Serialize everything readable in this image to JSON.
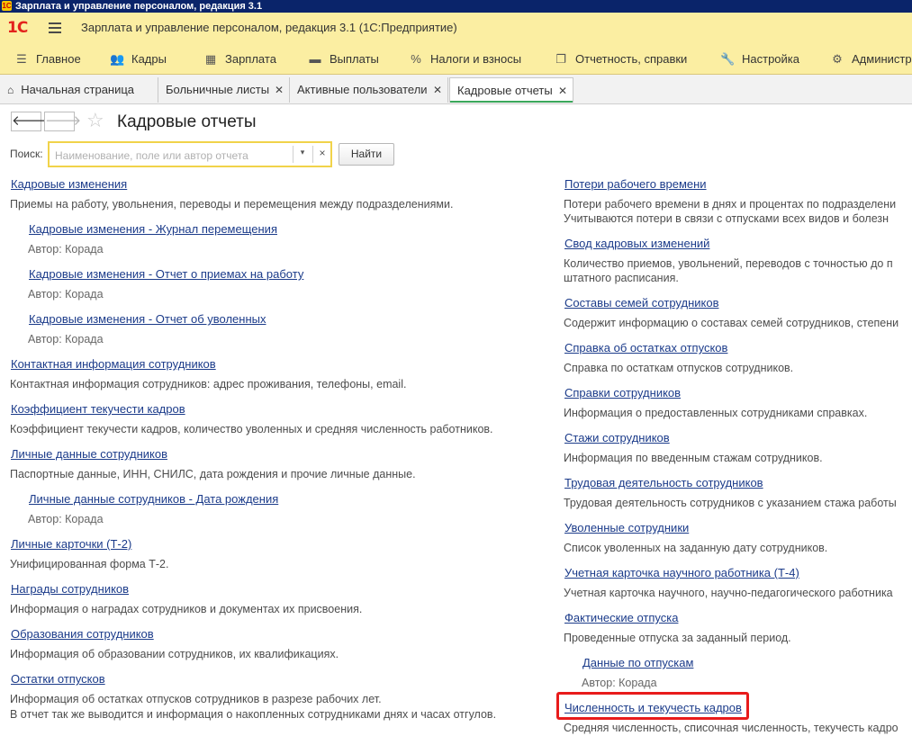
{
  "window": {
    "title": "Зарплата и управление персоналом, редакция 3.1"
  },
  "app": {
    "logo": "1С",
    "title": "Зарплата и управление персоналом, редакция 3.1  (1С:Предприятие)"
  },
  "sections": [
    {
      "label": "Главное",
      "icon": "hamburger-icon"
    },
    {
      "label": "Кадры",
      "icon": "people-icon"
    },
    {
      "label": "Зарплата",
      "icon": "calculator-icon"
    },
    {
      "label": "Выплаты",
      "icon": "wallet-icon"
    },
    {
      "label": "Налоги и взносы",
      "icon": "percent-icon"
    },
    {
      "label": "Отчетность, справки",
      "icon": "documents-icon"
    },
    {
      "label": "Настройка",
      "icon": "wrench-icon"
    },
    {
      "label": "Администрирование",
      "icon": "gear-icon"
    }
  ],
  "tabs": [
    {
      "label": "Начальная страница"
    },
    {
      "label": "Больничные листы"
    },
    {
      "label": "Активные пользователи"
    },
    {
      "label": "Кадровые отчеты"
    }
  ],
  "form": {
    "title": "Кадровые отчеты",
    "search_label": "Поиск:",
    "search_placeholder": "Наименование, поле или автор отчета",
    "search_value": "",
    "find_button": "Найти"
  },
  "left_reports": [
    {
      "name": "Кадровые изменения",
      "desc": "Приемы на работу, увольнения, переводы и перемещения между подразделениями."
    },
    {
      "name": "Кадровые изменения - Журнал перемещения",
      "author": "Автор: Корада"
    },
    {
      "name": "Кадровые изменения - Отчет о приемах на работу",
      "author": "Автор: Корада"
    },
    {
      "name": "Кадровые изменения - Отчет об уволенных",
      "author": "Автор: Корада"
    },
    {
      "name": "Контактная информация сотрудников",
      "desc": "Контактная информация сотрудников: адрес проживания, телефоны, email."
    },
    {
      "name": "Коэффициент текучести кадров",
      "desc": "Коэффициент текучести кадров, количество уволенных и средняя численность работников."
    },
    {
      "name": "Личные данные сотрудников",
      "desc": "Паспортные данные, ИНН, СНИЛС, дата рождения и прочие личные данные."
    },
    {
      "name": "Личные данные сотрудников - Дата рождения",
      "author": "Автор: Корада"
    },
    {
      "name": "Личные карточки (Т-2)",
      "desc": "Унифицированная форма Т-2."
    },
    {
      "name": "Награды сотрудников",
      "desc": "Информация о наградах сотрудников и документах их присвоения."
    },
    {
      "name": "Образования сотрудников",
      "desc": "Информация об образовании сотрудников, их квалификациях."
    },
    {
      "name": "Остатки отпусков",
      "desc": "Информация об остатках отпусков сотрудников в разрезе рабочих лет.",
      "desc2": "В отчет так же выводится и информация о накопленных сотрудниками днях и часах отгулов."
    }
  ],
  "right_reports": [
    {
      "name": "Потери рабочего времени",
      "desc": "Потери рабочего времени в днях и процентах по подразделени",
      "desc2": "Учитываются потери в связи с отпусками всех видов и болезн"
    },
    {
      "name": "Свод кадровых изменений",
      "desc": "Количество приемов, увольнений, переводов с точностью до п",
      "desc2": "штатного расписания."
    },
    {
      "name": "Составы семей сотрудников",
      "desc": "Содержит информацию о составах семей сотрудников, степени"
    },
    {
      "name": "Справка об остатках отпусков",
      "desc": "Справка по остаткам отпусков сотрудников."
    },
    {
      "name": "Справки сотрудников",
      "desc": "Информация о предоставленных сотрудниками справках."
    },
    {
      "name": "Стажи сотрудников",
      "desc": "Информация по введенным стажам сотрудников."
    },
    {
      "name": "Трудовая деятельность сотрудников",
      "desc": "Трудовая деятельность сотрудников с указанием стажа работы"
    },
    {
      "name": "Уволенные сотрудники",
      "desc": "Список уволенных на заданную дату сотрудников."
    },
    {
      "name": "Учетная карточка научного работника (Т-4)",
      "desc": "Учетная карточка научного, научно-педагогического работника"
    },
    {
      "name": "Фактические отпуска",
      "desc": "Проведенные отпуска за заданный период."
    },
    {
      "name": "Данные по отпускам",
      "author": "Автор: Корада"
    },
    {
      "name": "Численность и текучесть кадров",
      "desc": "Средняя численность, списочная численность, текучесть кадро"
    }
  ]
}
